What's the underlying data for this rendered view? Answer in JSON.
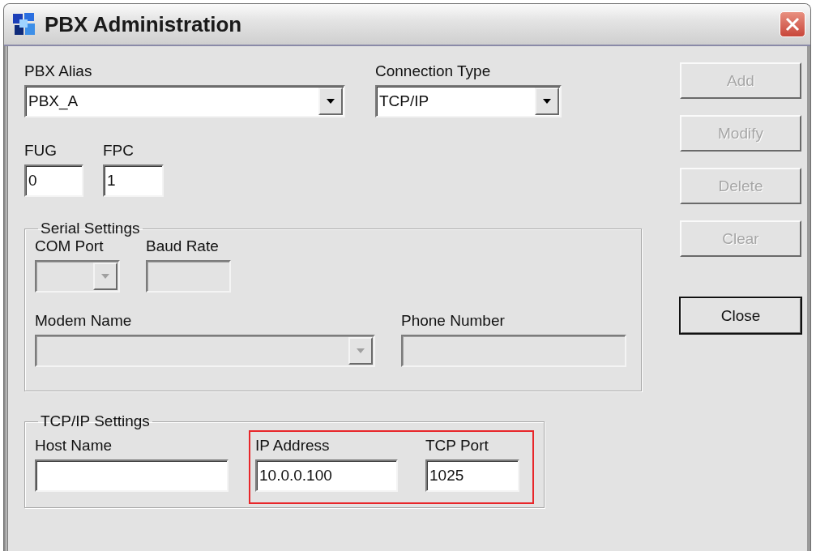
{
  "window": {
    "title": "PBX Administration"
  },
  "pbx_alias": {
    "label": "PBX Alias",
    "value": "PBX_A",
    "disabled": false
  },
  "connection_type": {
    "label": "Connection Type",
    "value": "TCP/IP",
    "disabled": false
  },
  "fug": {
    "label": "FUG",
    "value": "0",
    "disabled": false
  },
  "fpc": {
    "label": "FPC",
    "value": "1",
    "disabled": false
  },
  "serial_settings": {
    "title": "Serial Settings",
    "com_port": {
      "label": "COM Port",
      "disabled": true
    },
    "baud_rate": {
      "label": "Baud Rate",
      "disabled": true
    },
    "modem_name": {
      "label": "Modem Name",
      "disabled": true
    },
    "phone_number": {
      "label": "Phone Number",
      "disabled": true
    }
  },
  "tcpip_settings": {
    "title": "TCP/IP Settings",
    "highlighted": true,
    "host_name": {
      "label": "Host Name",
      "disabled": false
    },
    "ip_address": {
      "label": "IP Address",
      "value": "10.0.0.100",
      "disabled": false
    },
    "tcp_port": {
      "label": "TCP Port",
      "value": "1025",
      "disabled": false
    }
  },
  "buttons": [
    {
      "label": "Add",
      "disabled": true,
      "kind": "normal"
    },
    {
      "label": "Modify",
      "disabled": true,
      "kind": "normal"
    },
    {
      "label": "Delete",
      "disabled": true,
      "kind": "normal"
    },
    {
      "label": "Clear",
      "disabled": true,
      "kind": "normal"
    },
    {
      "label": "Close",
      "disabled": false,
      "kind": "default"
    }
  ]
}
